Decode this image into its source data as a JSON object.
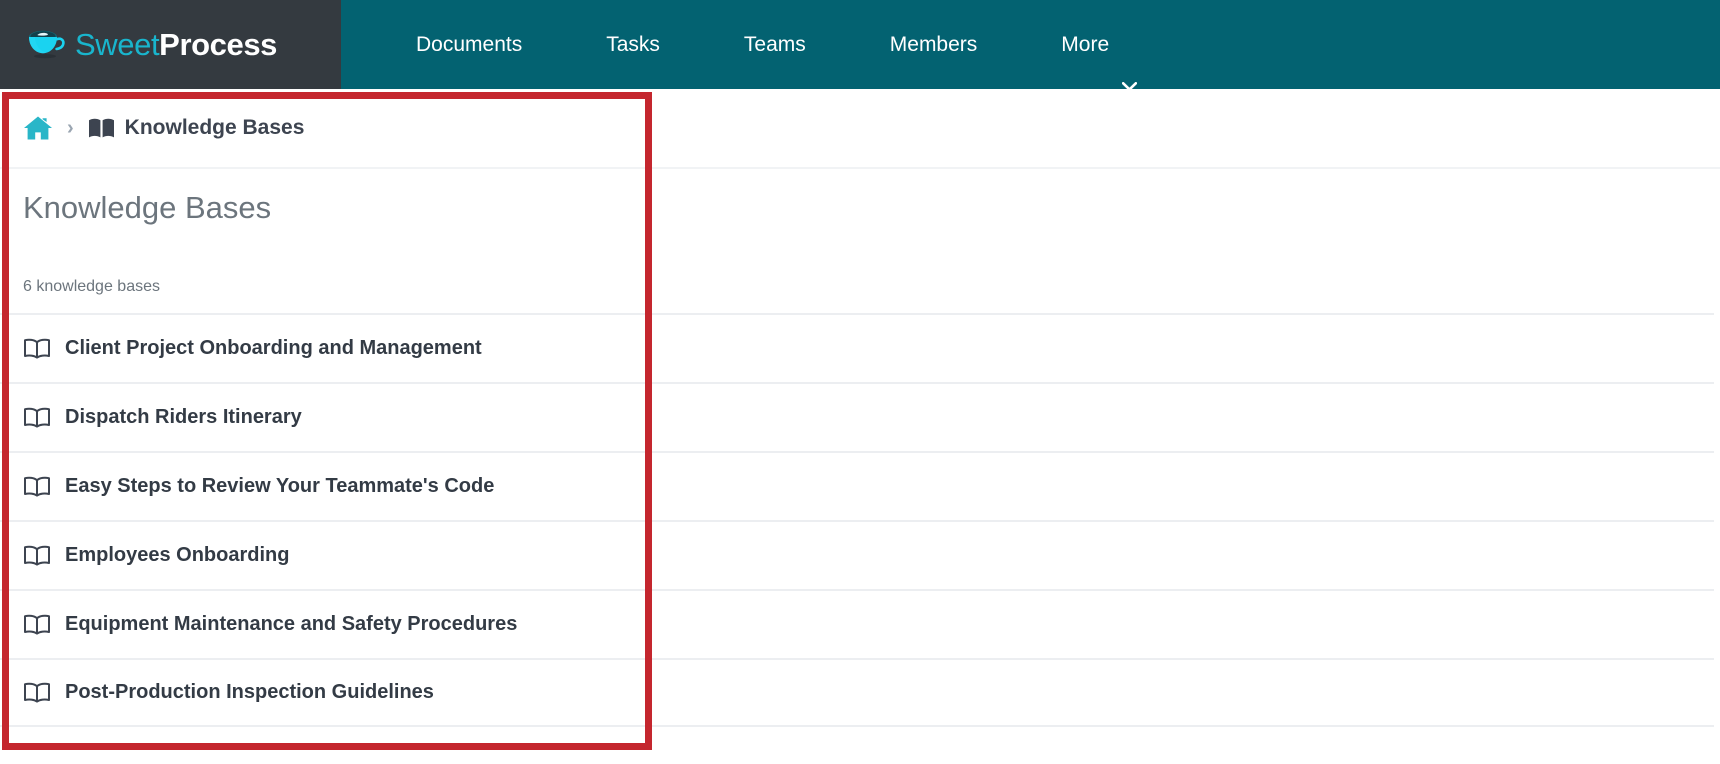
{
  "brand": {
    "icon": "coffee-cup-icon",
    "name_light": "Sweet",
    "name_bold": "Process"
  },
  "nav": {
    "items": [
      {
        "label": "Documents",
        "icon": null
      },
      {
        "label": "Tasks",
        "icon": null
      },
      {
        "label": "Teams",
        "icon": null
      },
      {
        "label": "Members",
        "icon": null
      },
      {
        "label": "More",
        "icon": "chevron-down-icon"
      }
    ]
  },
  "breadcrumb": {
    "home_icon": "home-icon",
    "separator": "›",
    "book_icon": "book-icon",
    "current": "Knowledge Bases"
  },
  "page": {
    "title": "Knowledge Bases",
    "count_label": "6 knowledge bases"
  },
  "knowledge_bases": [
    {
      "icon": "open-book-icon",
      "name": "Client Project Onboarding and Management"
    },
    {
      "icon": "open-book-icon",
      "name": "Dispatch Riders Itinerary"
    },
    {
      "icon": "open-book-icon",
      "name": "Easy Steps to Review Your Teammate's Code"
    },
    {
      "icon": "open-book-icon",
      "name": "Employees Onboarding"
    },
    {
      "icon": "open-book-icon",
      "name": "Equipment Maintenance and Safety Procedures"
    },
    {
      "icon": "open-book-icon",
      "name": "Post-Production Inspection Guidelines"
    }
  ],
  "colors": {
    "nav_teal": "#036271",
    "brand_dark": "#343a40",
    "brand_cyan": "#19b5cd",
    "annotation_red": "#c4262e",
    "text_dark": "#333b45",
    "text_muted": "#6c757d",
    "divider": "#eceef1"
  }
}
